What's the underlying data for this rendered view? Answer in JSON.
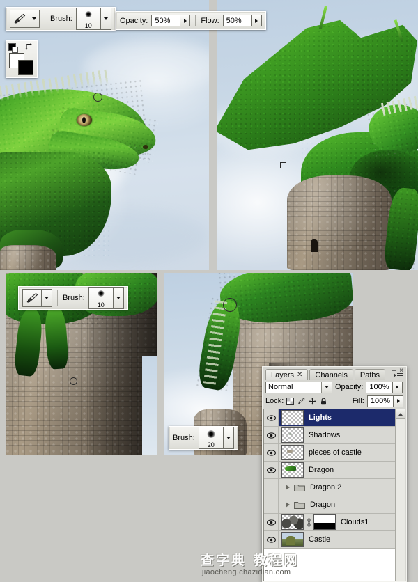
{
  "app": {
    "name": "Adobe Photoshop",
    "background_color": "#c9c9c5"
  },
  "toolbars": [
    {
      "id": "top-options-bar",
      "tool_icon": "paintbrush-icon",
      "brush_label": "Brush:",
      "brush_size": "10",
      "preset_arrow": "chevron-down-icon"
    },
    {
      "id": "opacity-flow-bar",
      "opacity_label": "Opacity:",
      "opacity_value": "50%",
      "flow_label": "Flow:",
      "flow_value": "50%"
    },
    {
      "id": "mid-options-bar",
      "tool_icon": "paintbrush-icon",
      "brush_label": "Brush:",
      "brush_size": "10"
    },
    {
      "id": "small-brush-bar",
      "brush_label": "Brush:",
      "brush_size": "20"
    }
  ],
  "color_swatch": {
    "foreground": "#ffffff",
    "background": "#000000",
    "default_icon": "default-colors-icon",
    "swap_icon": "swap-colors-icon"
  },
  "layers_panel": {
    "tabs": [
      {
        "label": "Layers",
        "active": true,
        "closable": true
      },
      {
        "label": "Channels",
        "active": false,
        "closable": false
      },
      {
        "label": "Paths",
        "active": false,
        "closable": false
      }
    ],
    "window_buttons": {
      "minimize": "–",
      "close": "×"
    },
    "blend_mode": "Normal",
    "opacity_label": "Opacity:",
    "opacity_value": "100%",
    "lock_label": "Lock:",
    "lock_icons": [
      "lock-transparent-pixels-icon",
      "lock-image-pixels-icon",
      "lock-position-icon",
      "lock-all-icon"
    ],
    "fill_label": "Fill:",
    "fill_value": "100%",
    "selected_layer": "Lights",
    "layers": [
      {
        "name": "Lights",
        "visible": true,
        "type": "pixel",
        "selected": true,
        "thumb": "empty"
      },
      {
        "name": "Shadows",
        "visible": true,
        "type": "pixel",
        "selected": false,
        "thumb": "sparse"
      },
      {
        "name": "pieces of castle",
        "visible": true,
        "type": "pixel",
        "selected": false,
        "thumb": "sparse"
      },
      {
        "name": "Dragon",
        "visible": true,
        "type": "pixel",
        "selected": false,
        "thumb": "dragon"
      },
      {
        "name": "Dragon 2",
        "visible": false,
        "type": "group",
        "selected": false,
        "thumb": "folder"
      },
      {
        "name": "Dragon",
        "visible": false,
        "type": "group",
        "selected": false,
        "thumb": "folder"
      },
      {
        "name": "Clouds1",
        "visible": true,
        "type": "masked",
        "selected": false,
        "thumb": "clouds"
      },
      {
        "name": "Castle",
        "visible": true,
        "type": "pixel",
        "selected": false,
        "thumb": "castle"
      }
    ],
    "scrollbar": {
      "up_arrow": "triangle-up-icon"
    },
    "colors": {
      "selected_row": "#1c2a6b",
      "row_background": "#d8d8d3",
      "panel_background": "#d6d6d1"
    }
  },
  "watermark": {
    "chinese": "查字典 教程网",
    "url": "jiaocheng.chazidian.com"
  },
  "canvases": [
    {
      "id": "canvas-top-left",
      "subject": "green dragon head close-up against sky"
    },
    {
      "id": "canvas-top-right",
      "subject": "green dragon with wing perched on stone tower"
    },
    {
      "id": "canvas-bottom-left",
      "subject": "dragon legs on stone castle wall"
    },
    {
      "id": "canvas-bottom-right",
      "subject": "dragon tail on castle battlement"
    }
  ]
}
